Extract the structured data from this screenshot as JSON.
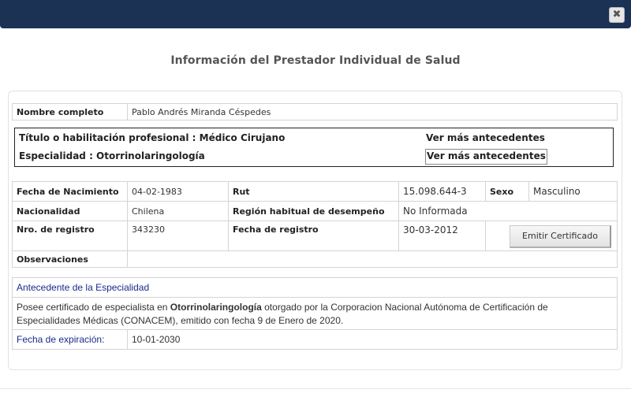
{
  "dialog": {
    "close_glyph": "✖",
    "heading": "Información del Prestador Individual de Salud"
  },
  "person": {
    "nombre_label": "Nombre completo",
    "nombre_value": "Pablo Andrés Miranda Céspedes"
  },
  "titles": {
    "titulo_text": "Título o habilitación profesional : Médico Cirujano",
    "titulo_link": "Ver más antecedentes",
    "especialidad_text": "Especialidad : Otorrinolaringología",
    "especialidad_link": "Ver más antecedentes"
  },
  "details": {
    "fecha_nac_label": "Fecha de Nacimiento",
    "fecha_nac_value": "04-02-1983",
    "rut_label": "Rut",
    "rut_value": "15.098.644-3",
    "sexo_label": "Sexo",
    "sexo_value": "Masculino",
    "nacionalidad_label": "Nacionalidad",
    "nacionalidad_value": "Chilena",
    "region_label": "Región habitual de desempeño",
    "region_value": "No Informada",
    "nro_registro_label": "Nro. de registro",
    "nro_registro_value": "343230",
    "fecha_registro_label": "Fecha de registro",
    "fecha_registro_value": "30-03-2012",
    "emit_button": "Emitir Certificado",
    "observaciones_label": "Observaciones",
    "observaciones_value": ""
  },
  "antecedente": {
    "title": "Antecedente de la Especialidad",
    "desc_before": "Posee certificado de especialista en ",
    "desc_bold": "Otorrinolaringología",
    "desc_after": " otorgado por la Corporacion Nacional Autónoma de Certificación de Especialidades Médicas (CONACEM), emitido con fecha 9 de Enero de 2020.",
    "expiracion_label": "Fecha de expiración:",
    "expiracion_value": "10-01-2030"
  }
}
